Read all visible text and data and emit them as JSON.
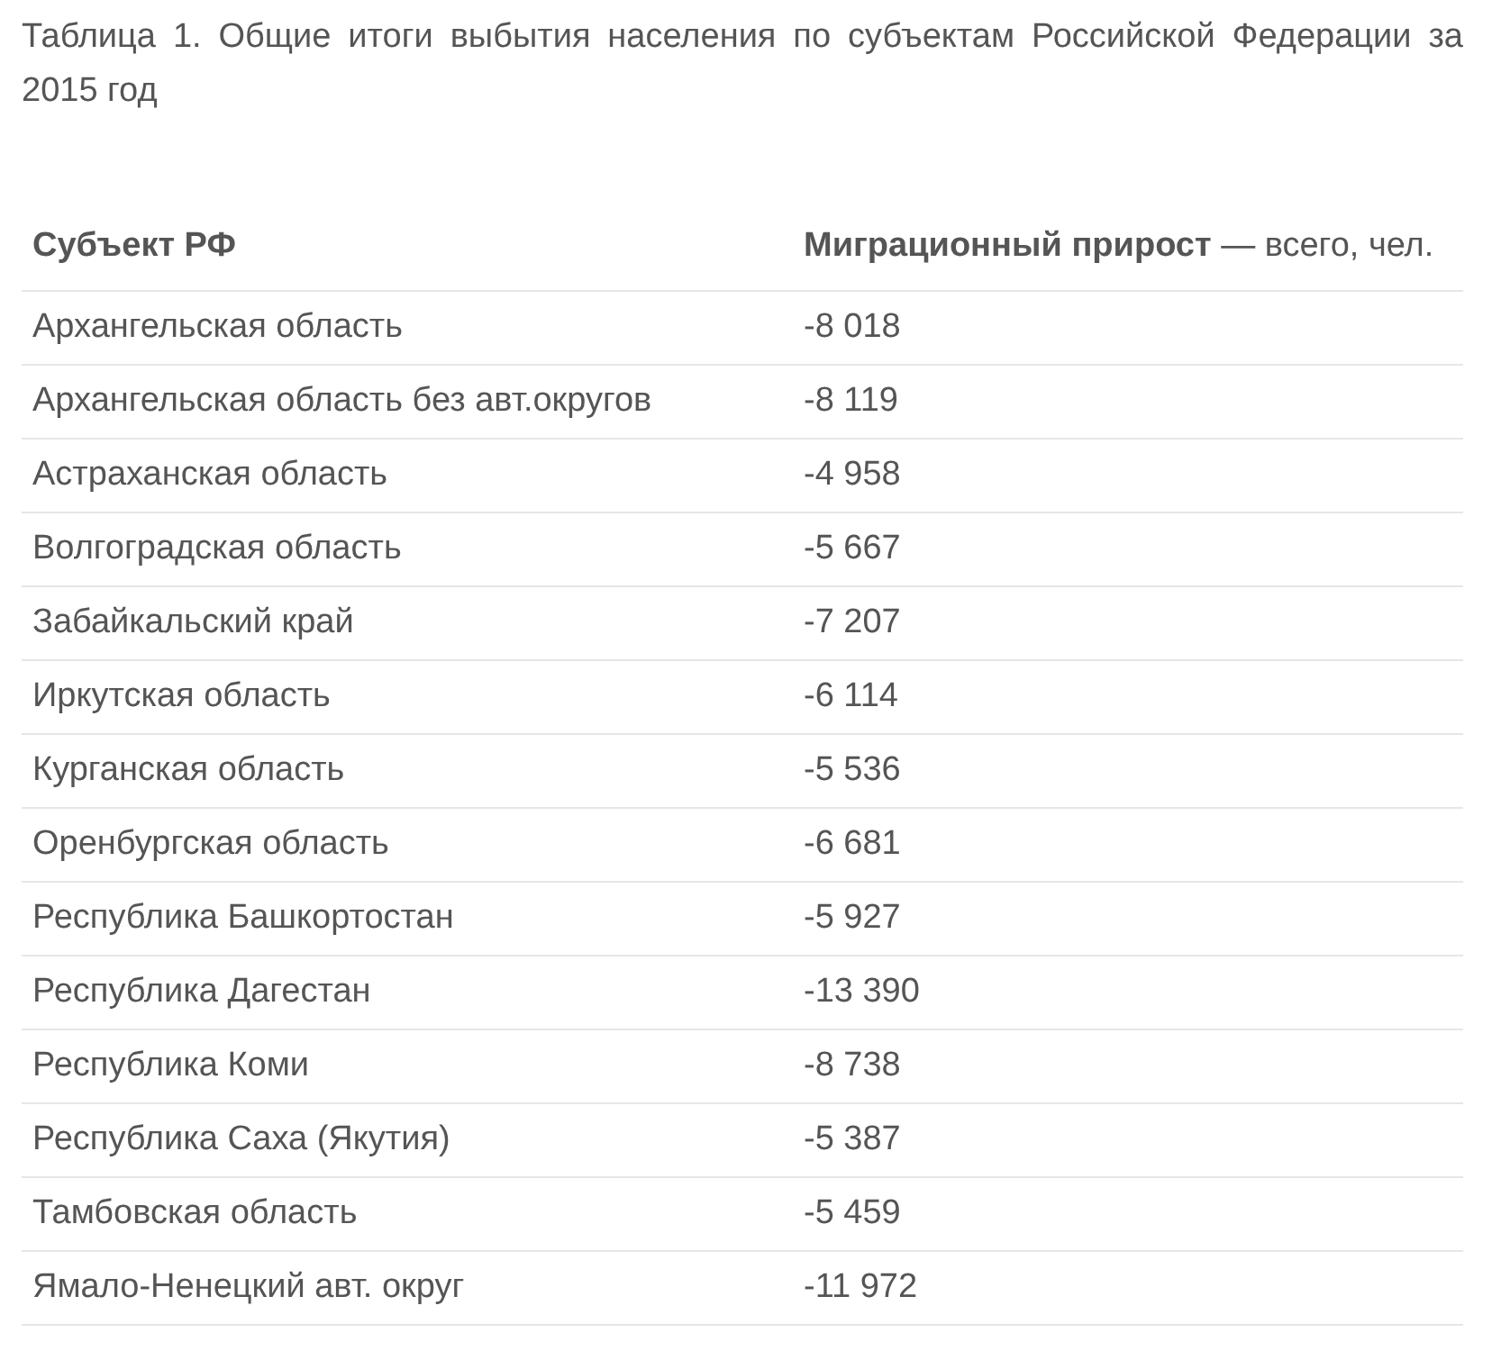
{
  "caption": "Таблица 1. Общие итоги выбытия населения по субъектам Российской Федерации за 2015 год",
  "table": {
    "columns": [
      "Субъект РФ",
      "**Миграционный прирост** — всего, чел."
    ],
    "rows": [
      [
        "Архангельская область",
        "-8 018"
      ],
      [
        "Архангельская область без авт.округов",
        "-8 119"
      ],
      [
        "Астраханская область",
        "-4 958"
      ],
      [
        "Волгоградская область",
        "-5 667"
      ],
      [
        "Забайкальский край",
        "-7 207"
      ],
      [
        "Иркутская область",
        "-6 114"
      ],
      [
        "Курганская область",
        "-5 536"
      ],
      [
        "Оренбургская область",
        "-6 681"
      ],
      [
        "Республика Башкортостан",
        "-5 927"
      ],
      [
        "Республика Дагестан",
        "-13 390"
      ],
      [
        "Республика Коми",
        "-8 738"
      ],
      [
        "Республика Саха (Якутия)",
        "-5 387"
      ],
      [
        "Тамбовская область",
        "-5 459"
      ],
      [
        "Ямало-Ненецкий авт. округ",
        "-11 972"
      ]
    ]
  }
}
